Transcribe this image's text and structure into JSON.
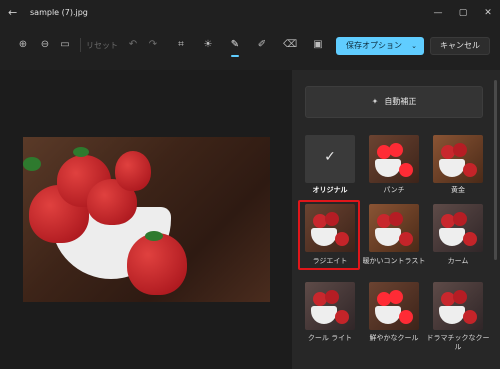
{
  "window": {
    "title": "sample (7).jpg"
  },
  "toolbar": {
    "reset_label": "リセット",
    "save_label": "保存オプション",
    "cancel_label": "キャンセル"
  },
  "panel": {
    "auto_enhance_label": "自動補正",
    "filters": [
      {
        "label": "オリジナル"
      },
      {
        "label": "パンチ"
      },
      {
        "label": "黄金"
      },
      {
        "label": "ラジエイト"
      },
      {
        "label": "暖かいコントラスト"
      },
      {
        "label": "カーム"
      },
      {
        "label": "クール ライト"
      },
      {
        "label": "鮮やかなクール"
      },
      {
        "label": "ドラマチックなクール"
      }
    ]
  },
  "colors": {
    "accent": "#60cdff",
    "highlight": "#e0161a",
    "panel_bg": "#272727",
    "window_bg": "#202020"
  },
  "icons": [
    "back-arrow-icon",
    "minimize-icon",
    "maximize-icon",
    "close-icon",
    "zoom-in-icon",
    "zoom-out-icon",
    "actual-size-icon",
    "undo-icon",
    "redo-icon",
    "crop-icon",
    "adjust-icon",
    "filter-icon",
    "markup-icon",
    "erase-icon",
    "effects-icon",
    "magic-wand-icon",
    "check-icon"
  ]
}
